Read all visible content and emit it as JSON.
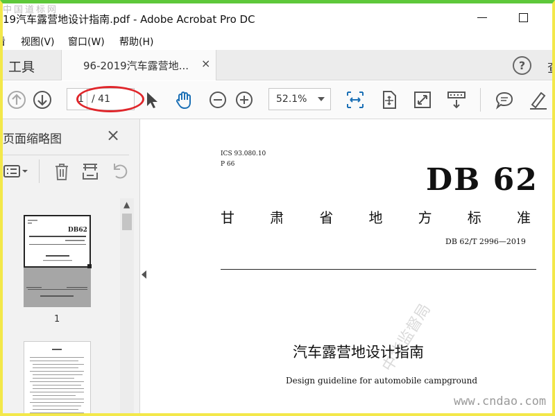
{
  "window": {
    "title": "19汽车露营地设计指南.pdf - Adobe Acrobat Pro DC",
    "watermark_top": "中国道标网"
  },
  "menu": {
    "items": [
      "看",
      "视图(V)",
      "窗口(W)",
      "帮助(H)"
    ]
  },
  "tabs": {
    "tools_label": "工具",
    "doc_tab_label": "96-2019汽车露营地...",
    "close_glyph": "×",
    "help_glyph": "?",
    "search_partial": "查"
  },
  "toolbar": {
    "page_current": "1",
    "page_total": "/ 41",
    "zoom": "52.1%"
  },
  "thumbnail_panel": {
    "title": "页面缩略图",
    "close_glyph": "×",
    "thumbs": [
      {
        "label": "1"
      },
      {
        "label": ""
      }
    ]
  },
  "document": {
    "ics": "ICS  93.080.10",
    "p_code": "P  66",
    "logo": "DB 62",
    "std_title_chars": [
      "甘",
      "肃",
      "省",
      "地",
      "方",
      "标",
      "准"
    ],
    "std_number": "DB 62/T  2996—2019",
    "title_cn": "汽车露营地设计指南",
    "title_en": "Design guideline for automobile campground",
    "watermark_diag": "中华监督局",
    "watermark_bottom": "www.cndao.com"
  },
  "colors": {
    "frame_top": "#5ec83a",
    "frame_side": "#f3e84a",
    "annotation_ellipse": "#e0262b",
    "icon_blue": "#1a6fb5"
  }
}
